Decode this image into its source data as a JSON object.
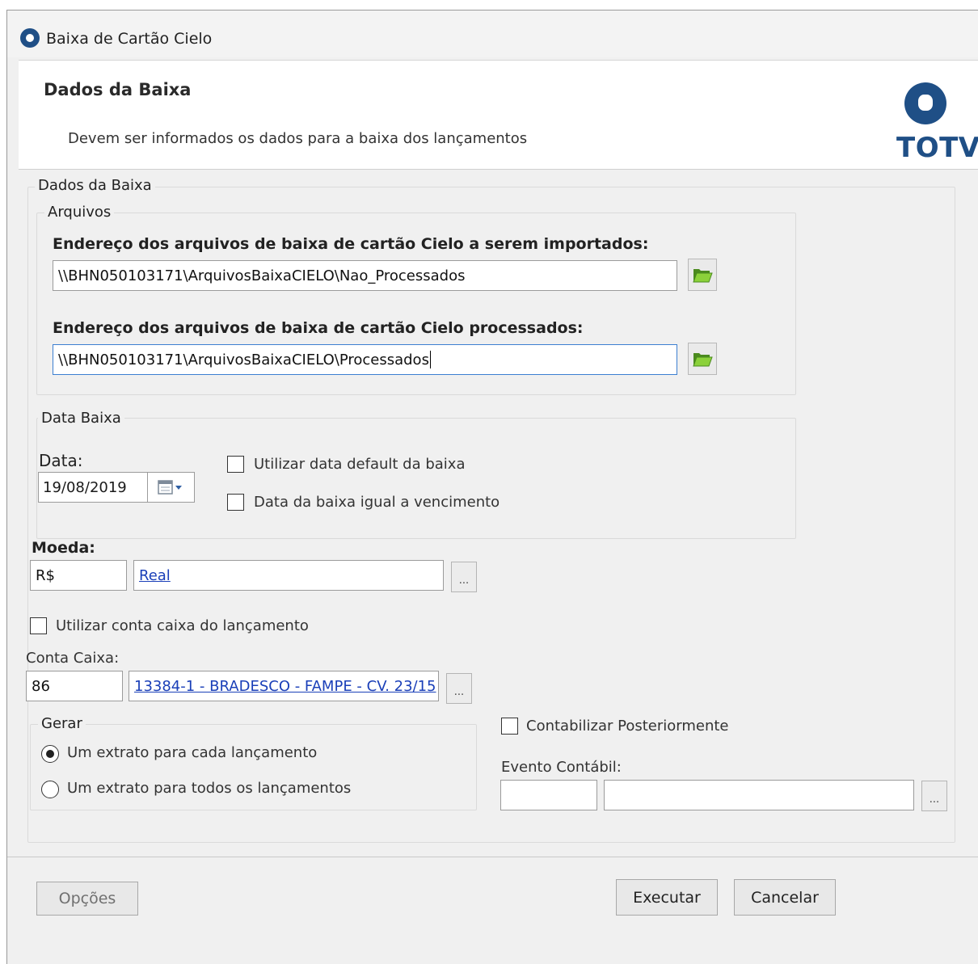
{
  "window": {
    "title": "Baixa de Cartão Cielo"
  },
  "header": {
    "title": "Dados da Baixa",
    "subtitle": "Devem ser informados os dados para a baixa dos lançamentos",
    "logo_text": "TOTVS",
    "brand_color": "#1f4f86"
  },
  "dados_baixa": {
    "group_label": "Dados da Baixa",
    "arquivos": {
      "group_label": "Arquivos",
      "import_label": "Endereço dos arquivos de baixa de cartão Cielo a serem importados:",
      "import_path": "\\\\BHN050103171\\ArquivosBaixaCIELO\\Nao_Processados",
      "processed_label": "Endereço dos arquivos de baixa de cartão Cielo processados:",
      "processed_path": "\\\\BHN050103171\\ArquivosBaixaCIELO\\Processados"
    },
    "data_baixa": {
      "group_label": "Data Baixa",
      "date_label": "Data:",
      "date_value": "19/08/2019",
      "default_date_label": "Utilizar data default da baixa",
      "default_date_checked": false,
      "due_date_label": "Data da baixa igual a vencimento",
      "due_date_checked": false
    },
    "moeda": {
      "label": "Moeda:",
      "code": "R$",
      "name": "Real"
    },
    "conta_caixa_lancamento": {
      "label": "Utilizar conta caixa do lançamento",
      "checked": false
    },
    "conta_caixa": {
      "label": "Conta Caixa:",
      "code": "86",
      "name": "13384-1 - BRADESCO - FAMPE - CV. 23/15"
    },
    "gerar": {
      "group_label": "Gerar",
      "options": [
        {
          "label": "Um extrato para cada lançamento",
          "selected": true
        },
        {
          "label": "Um extrato para todos os lançamentos",
          "selected": false
        }
      ]
    },
    "contabilizar": {
      "label": "Contabilizar Posteriormente",
      "checked": false
    },
    "evento_contabil": {
      "label": "Evento Contábil:",
      "code": "",
      "name": ""
    }
  },
  "footer": {
    "options_label": "Opções",
    "execute_label": "Executar",
    "cancel_label": "Cancelar"
  }
}
